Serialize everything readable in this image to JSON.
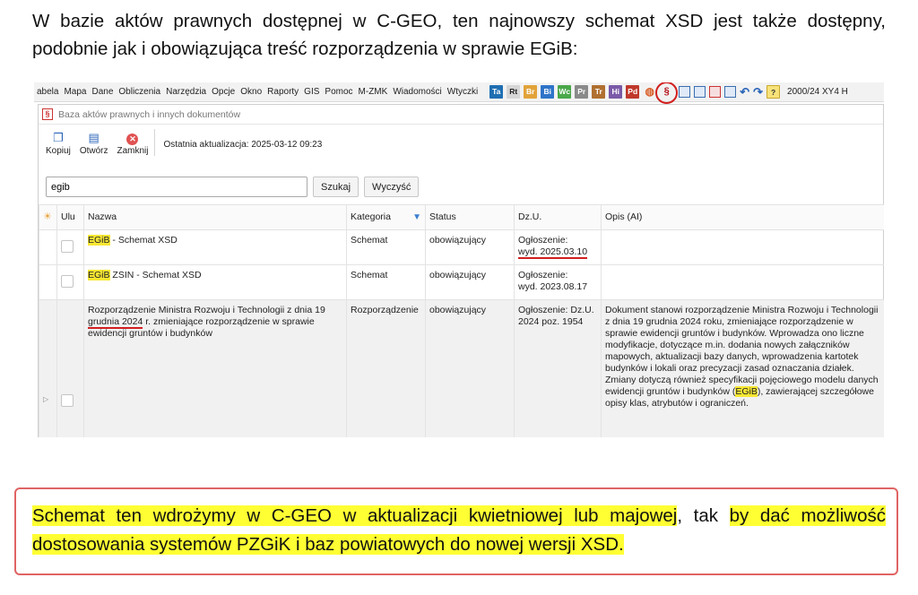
{
  "intro_text": "W bazie aktów prawnych dostępnej w C-GEO, ten najnowszy schemat XSD jest także dostępny, podobnie jak i obowiązująca treść rozporządzenia w sprawie EGiB:",
  "menubar": {
    "items": [
      "abela",
      "Mapa",
      "Dane",
      "Obliczenia",
      "Narzędzia",
      "Opcje",
      "Okno",
      "Raporty",
      "GIS",
      "Pomoc",
      "M-ZMK",
      "Wiadomości",
      "Wtyczki"
    ],
    "toolbar_badges": [
      {
        "text": "Ta",
        "bg": "#1f6fb2",
        "fg": "#ffffff"
      },
      {
        "text": "Rt",
        "bg": "#d6d6d6",
        "fg": "#222222"
      },
      {
        "text": "Br",
        "bg": "#e2a33a",
        "fg": "#ffffff"
      },
      {
        "text": "Bi",
        "bg": "#2e74c9",
        "fg": "#ffffff"
      },
      {
        "text": "Wc",
        "bg": "#4aa84a",
        "fg": "#ffffff"
      },
      {
        "text": "Pr",
        "bg": "#8a8a8a",
        "fg": "#ffffff"
      },
      {
        "text": "Tr",
        "bg": "#b07030",
        "fg": "#ffffff"
      },
      {
        "text": "Hi",
        "bg": "#7a5aa8",
        "fg": "#ffffff"
      },
      {
        "text": "Pd",
        "bg": "#c0392b",
        "fg": "#ffffff"
      }
    ],
    "law_icon": "§",
    "version_text": "2000/24 XY4 H"
  },
  "window": {
    "title": "Baza aktów prawnych i innych dokumentów",
    "title_icon": "§",
    "buttons": {
      "copy": "Kopiuj",
      "open": "Otwórz",
      "close": "Zamknij"
    },
    "last_update": "Ostatnia aktualizacja: 2025-03-12 09:23",
    "search": {
      "value": "egib",
      "search_label": "Szukaj",
      "clear_label": "Wyczyść"
    }
  },
  "table": {
    "columns": {
      "ulu": "Ulu",
      "name": "Nazwa",
      "category": "Kategoria",
      "status": "Status",
      "dzu": "Dz.U.",
      "desc": "Opis (AI)"
    },
    "rows": [
      {
        "name_hl": "EGiB",
        "name_rest": " - Schemat XSD",
        "category": "Schemat",
        "status": "obowiązujący",
        "dzu_line1": "Ogłoszenie:",
        "dzu_line2": "wyd. 2025.03.10",
        "desc": ""
      },
      {
        "name_hl": "EGiB",
        "name_rest": " ZSIN - Schemat XSD",
        "category": "Schemat",
        "status": "obowiązujący",
        "dzu_line1": "Ogłoszenie:",
        "dzu_line2": "wyd. 2023.08.17",
        "desc": ""
      },
      {
        "name_a": "Rozporządzenie Ministra Rozwoju i Technologii z dnia 19 ",
        "name_ul": "grudnia 2024",
        "name_b": " r. zmieniające rozporządzenie w sprawie ewidencji gruntów i budynków",
        "category": "Rozporządzenie",
        "status": "obowiązujący",
        "dzu": "Ogłoszenie: Dz.U. 2024 poz. 1954",
        "desc_a": "Dokument stanowi rozporządzenie Ministra Rozwoju i Technologii z dnia 19 grudnia 2024 roku, zmieniające rozporządzenie w sprawie ewidencji gruntów i budynków. Wprowadza ono liczne modyfikacje, dotyczące m.in. dodania nowych załączników mapowych, aktualizacji bazy danych, wprowadzenia kartotek budynków i lokali oraz precyzacji zasad oznaczania działek. Zmiany dotyczą również specyfikacji pojęciowego modelu danych ewidencji gruntów i budynków (",
        "desc_hl": "EGiB",
        "desc_b": "), zawierającej szczegółowe opisy klas, atrybutów i ograniczeń."
      }
    ]
  },
  "callout": {
    "part1": "Schemat ten wdrożymy w C-GEO w aktualizacji kwietniowej lub majowej",
    "part2": ", tak ",
    "part3": "by dać możliwość dostosowania systemów PZGiK i baz powiatowych do nowej wersji XSD."
  }
}
